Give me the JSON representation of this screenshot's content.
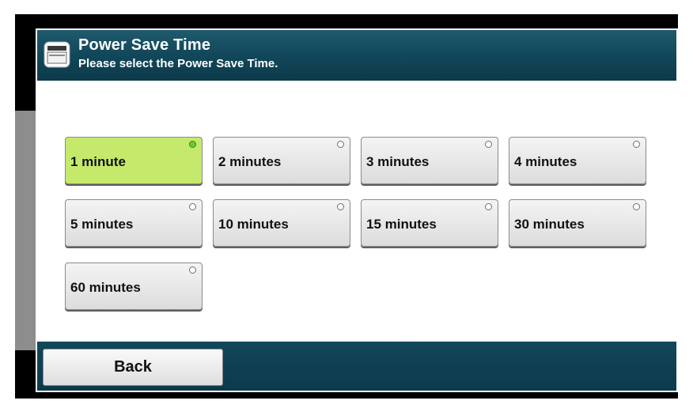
{
  "header": {
    "title": "Power Save Time",
    "subtitle": "Please select the Power Save Time."
  },
  "options": [
    {
      "label": "1 minute",
      "selected": true
    },
    {
      "label": "2 minutes",
      "selected": false
    },
    {
      "label": "3 minutes",
      "selected": false
    },
    {
      "label": "4 minutes",
      "selected": false
    },
    {
      "label": "5 minutes",
      "selected": false
    },
    {
      "label": "10 minutes",
      "selected": false
    },
    {
      "label": "15 minutes",
      "selected": false
    },
    {
      "label": "30 minutes",
      "selected": false
    },
    {
      "label": "60 minutes",
      "selected": false
    }
  ],
  "footer": {
    "back_label": "Back"
  },
  "colors": {
    "header_bg": "#12475a",
    "selected_bg": "#c5ea6b",
    "selected_indicator": "#6ec83c"
  },
  "icons": {
    "header": "panel-display-icon",
    "option_indicator": "radio-indicator-icon"
  }
}
